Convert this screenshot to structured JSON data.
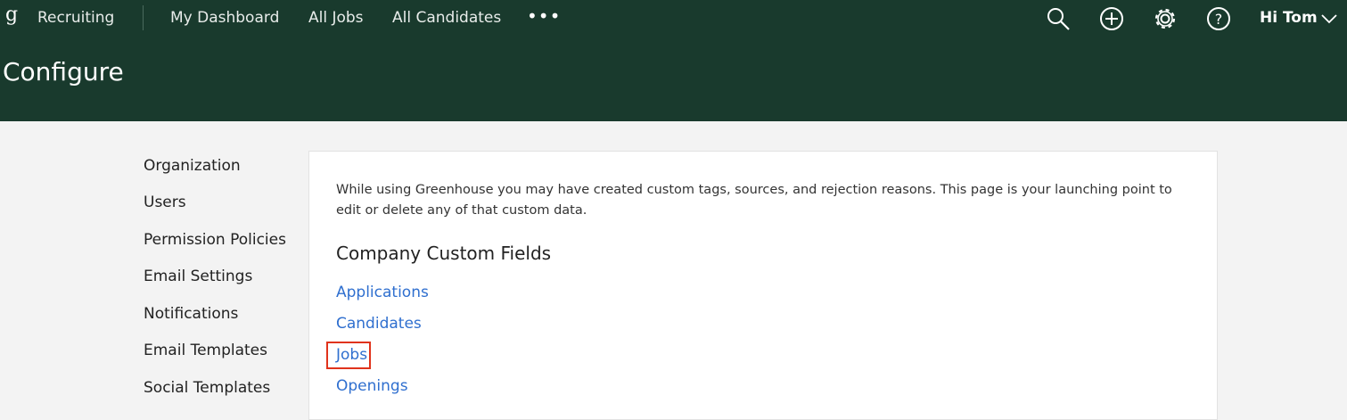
{
  "nav": {
    "logo": "g",
    "app_name": "Recruiting",
    "links": [
      "My Dashboard",
      "All Jobs",
      "All Candidates"
    ],
    "more": "•••",
    "greeting": "Hi Tom",
    "icons": [
      "search-icon",
      "plus-circle-icon",
      "gear-icon",
      "help-icon",
      "chevron-down-icon"
    ]
  },
  "page": {
    "title": "Configure"
  },
  "sidebar": {
    "items": [
      "Organization",
      "Users",
      "Permission Policies",
      "Email Settings",
      "Notifications",
      "Email Templates",
      "Social Templates"
    ]
  },
  "main": {
    "intro": "While using Greenhouse you may have created custom tags, sources, and rejection reasons. This page is your launching point to edit or delete any of that custom data.",
    "section_title": "Company Custom Fields",
    "links": [
      "Applications",
      "Candidates",
      "Jobs",
      "Openings"
    ]
  },
  "colors": {
    "header_bg": "#193a2d",
    "link": "#2f6fcf",
    "highlight": "#e0331c",
    "page_bg": "#f3f3f3"
  }
}
